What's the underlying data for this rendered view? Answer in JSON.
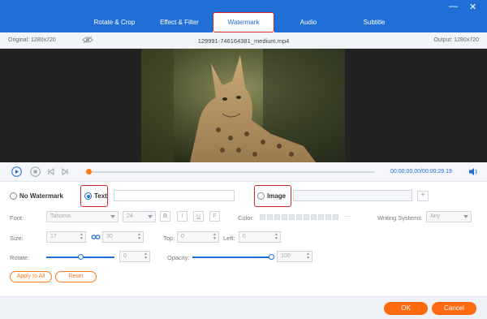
{
  "tabs": [
    {
      "label": "Rotate & Crop"
    },
    {
      "label": "Effect & Filter"
    },
    {
      "label": "Watermark"
    },
    {
      "label": "Audio"
    },
    {
      "label": "Subtitle"
    }
  ],
  "info": {
    "original": "Original: 1280x720",
    "filename": "129991-746164381_medium.mp4",
    "output": "Output: 1280x720"
  },
  "playback": {
    "time": "00:00:00.00/00:00:29.19",
    "progress": 0.0
  },
  "watermark": {
    "no_watermark_label": "No Watermark",
    "text_label": "Text",
    "text_value": "",
    "image_label": "Image",
    "image_value": "",
    "selected": "Text"
  },
  "text_settings": {
    "font_label": "Font:",
    "font_value": "Tahoma",
    "size_option": "24",
    "format_buttons": [
      "B",
      "I",
      "U",
      "F"
    ],
    "color_label": "Color:",
    "writing_label": "Writing Systems:",
    "writing_value": "Any"
  },
  "size_settings": {
    "size_label": "Size:",
    "width": "17",
    "height": "30",
    "top_label": "Top:",
    "top_value": "0",
    "left_label": "Left:",
    "left_value": "0"
  },
  "rotate_settings": {
    "rotate_label": "Rotate:",
    "rotate_value": "0",
    "opacity_label": "Opacity:",
    "opacity_value": "100"
  },
  "actions": {
    "apply_all": "Apply to All",
    "reset": "Reset",
    "ok": "OK",
    "cancel": "Cancel"
  },
  "colors": {
    "accent": "#1f6fd6",
    "orange": "#ff6a10",
    "highlight": "#d9262c"
  }
}
